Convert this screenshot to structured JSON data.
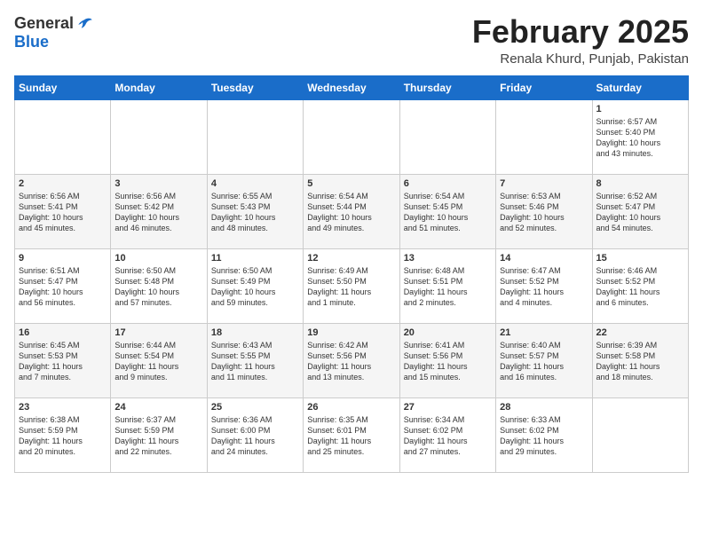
{
  "header": {
    "logo_general": "General",
    "logo_blue": "Blue",
    "month_title": "February 2025",
    "location": "Renala Khurd, Punjab, Pakistan"
  },
  "weekdays": [
    "Sunday",
    "Monday",
    "Tuesday",
    "Wednesday",
    "Thursday",
    "Friday",
    "Saturday"
  ],
  "weeks": [
    [
      {
        "day": "",
        "info": ""
      },
      {
        "day": "",
        "info": ""
      },
      {
        "day": "",
        "info": ""
      },
      {
        "day": "",
        "info": ""
      },
      {
        "day": "",
        "info": ""
      },
      {
        "day": "",
        "info": ""
      },
      {
        "day": "1",
        "info": "Sunrise: 6:57 AM\nSunset: 5:40 PM\nDaylight: 10 hours\nand 43 minutes."
      }
    ],
    [
      {
        "day": "2",
        "info": "Sunrise: 6:56 AM\nSunset: 5:41 PM\nDaylight: 10 hours\nand 45 minutes."
      },
      {
        "day": "3",
        "info": "Sunrise: 6:56 AM\nSunset: 5:42 PM\nDaylight: 10 hours\nand 46 minutes."
      },
      {
        "day": "4",
        "info": "Sunrise: 6:55 AM\nSunset: 5:43 PM\nDaylight: 10 hours\nand 48 minutes."
      },
      {
        "day": "5",
        "info": "Sunrise: 6:54 AM\nSunset: 5:44 PM\nDaylight: 10 hours\nand 49 minutes."
      },
      {
        "day": "6",
        "info": "Sunrise: 6:54 AM\nSunset: 5:45 PM\nDaylight: 10 hours\nand 51 minutes."
      },
      {
        "day": "7",
        "info": "Sunrise: 6:53 AM\nSunset: 5:46 PM\nDaylight: 10 hours\nand 52 minutes."
      },
      {
        "day": "8",
        "info": "Sunrise: 6:52 AM\nSunset: 5:47 PM\nDaylight: 10 hours\nand 54 minutes."
      }
    ],
    [
      {
        "day": "9",
        "info": "Sunrise: 6:51 AM\nSunset: 5:47 PM\nDaylight: 10 hours\nand 56 minutes."
      },
      {
        "day": "10",
        "info": "Sunrise: 6:50 AM\nSunset: 5:48 PM\nDaylight: 10 hours\nand 57 minutes."
      },
      {
        "day": "11",
        "info": "Sunrise: 6:50 AM\nSunset: 5:49 PM\nDaylight: 10 hours\nand 59 minutes."
      },
      {
        "day": "12",
        "info": "Sunrise: 6:49 AM\nSunset: 5:50 PM\nDaylight: 11 hours\nand 1 minute."
      },
      {
        "day": "13",
        "info": "Sunrise: 6:48 AM\nSunset: 5:51 PM\nDaylight: 11 hours\nand 2 minutes."
      },
      {
        "day": "14",
        "info": "Sunrise: 6:47 AM\nSunset: 5:52 PM\nDaylight: 11 hours\nand 4 minutes."
      },
      {
        "day": "15",
        "info": "Sunrise: 6:46 AM\nSunset: 5:52 PM\nDaylight: 11 hours\nand 6 minutes."
      }
    ],
    [
      {
        "day": "16",
        "info": "Sunrise: 6:45 AM\nSunset: 5:53 PM\nDaylight: 11 hours\nand 7 minutes."
      },
      {
        "day": "17",
        "info": "Sunrise: 6:44 AM\nSunset: 5:54 PM\nDaylight: 11 hours\nand 9 minutes."
      },
      {
        "day": "18",
        "info": "Sunrise: 6:43 AM\nSunset: 5:55 PM\nDaylight: 11 hours\nand 11 minutes."
      },
      {
        "day": "19",
        "info": "Sunrise: 6:42 AM\nSunset: 5:56 PM\nDaylight: 11 hours\nand 13 minutes."
      },
      {
        "day": "20",
        "info": "Sunrise: 6:41 AM\nSunset: 5:56 PM\nDaylight: 11 hours\nand 15 minutes."
      },
      {
        "day": "21",
        "info": "Sunrise: 6:40 AM\nSunset: 5:57 PM\nDaylight: 11 hours\nand 16 minutes."
      },
      {
        "day": "22",
        "info": "Sunrise: 6:39 AM\nSunset: 5:58 PM\nDaylight: 11 hours\nand 18 minutes."
      }
    ],
    [
      {
        "day": "23",
        "info": "Sunrise: 6:38 AM\nSunset: 5:59 PM\nDaylight: 11 hours\nand 20 minutes."
      },
      {
        "day": "24",
        "info": "Sunrise: 6:37 AM\nSunset: 5:59 PM\nDaylight: 11 hours\nand 22 minutes."
      },
      {
        "day": "25",
        "info": "Sunrise: 6:36 AM\nSunset: 6:00 PM\nDaylight: 11 hours\nand 24 minutes."
      },
      {
        "day": "26",
        "info": "Sunrise: 6:35 AM\nSunset: 6:01 PM\nDaylight: 11 hours\nand 25 minutes."
      },
      {
        "day": "27",
        "info": "Sunrise: 6:34 AM\nSunset: 6:02 PM\nDaylight: 11 hours\nand 27 minutes."
      },
      {
        "day": "28",
        "info": "Sunrise: 6:33 AM\nSunset: 6:02 PM\nDaylight: 11 hours\nand 29 minutes."
      },
      {
        "day": "",
        "info": ""
      }
    ]
  ]
}
